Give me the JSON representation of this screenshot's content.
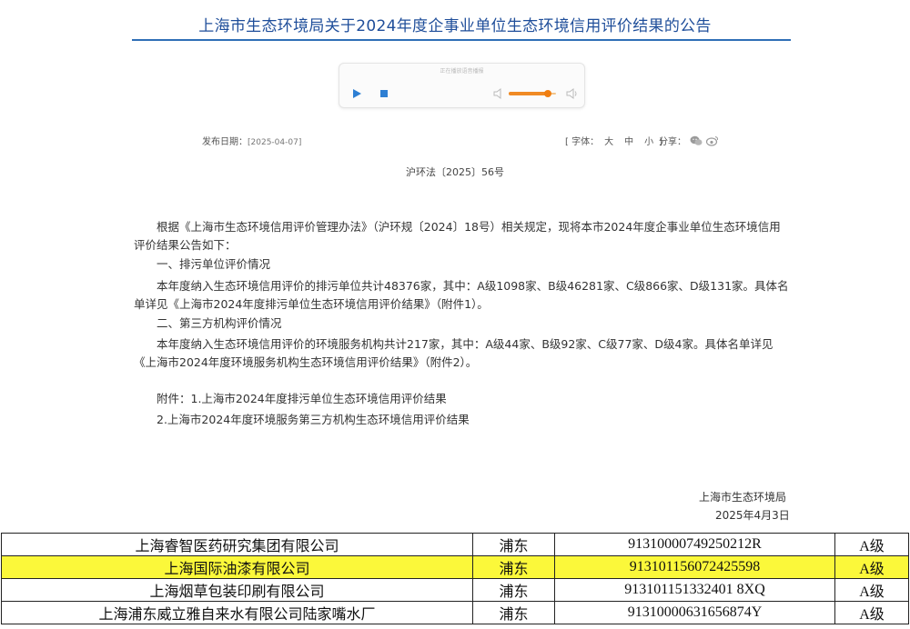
{
  "header": {
    "title": "上海市生态环境局关于2024年度企事业单位生态环境信用评价结果的公告"
  },
  "player": {
    "caption": "正在播放语音播报",
    "volume_percent": 82,
    "accent_color": "#f07e10",
    "icons": [
      "play-icon",
      "stop-icon",
      "volume-low-icon",
      "volume-high-icon"
    ]
  },
  "meta": {
    "publish_label": "发布日期：",
    "publish_date": "[2025-04-07]",
    "font_label": "[ 字体：",
    "font_large": "大",
    "font_medium": "中",
    "font_small": "小",
    "font_close": "]",
    "share_label": "分享：",
    "share_icons": [
      "wechat-icon",
      "weibo-icon"
    ]
  },
  "doc_number": "沪环法〔2025〕56号",
  "paragraphs": [
    "根据《上海市生态环境信用评价管理办法》（沪环规〔2024〕18号）相关规定，现将本市2024年度企事业单位生态环境信用评价结果公告如下：",
    "一、排污单位评价情况",
    "本年度纳入生态环境信用评价的排污单位共计48376家，其中：A级1098家、B级46281家、C级866家、D级131家。具体名单详见《上海市2024年度排污单位生态环境信用评价结果》（附件1）。",
    "二、第三方机构评价情况",
    "本年度纳入生态环境信用评价的环境服务机构共计217家，其中：A级44家、B级92家、C级77家、D级4家。具体名单详见《上海市2024年度环境服务机构生态环境信用评价结果》（附件2）。"
  ],
  "attachments": [
    "附件：1.上海市2024年度排污单位生态环境信用评价结果",
    "2.上海市2024年度环境服务第三方机构生态环境信用评价结果"
  ],
  "signature": {
    "org": "上海市生态环境局",
    "date": "2025年4月3日"
  },
  "table": {
    "highlight_color": "#fbf83a",
    "rows": [
      {
        "name": "上海睿智医药研究集团有限公司",
        "district": "浦东",
        "code": "91310000749250212R",
        "grade": "A级",
        "highlight": false
      },
      {
        "name": "上海国际油漆有限公司",
        "district": "浦东",
        "code": "913101156072425598",
        "grade": "A级",
        "highlight": true
      },
      {
        "name": "上海烟草包装印刷有限公司",
        "district": "浦东",
        "code": "913101151332401 8XQ",
        "grade": "A级",
        "highlight": false
      },
      {
        "name": "上海浦东威立雅自来水有限公司陆家嘴水厂",
        "district": "浦东",
        "code": "91310000631656874Y",
        "grade": "A级",
        "highlight": false
      }
    ]
  }
}
